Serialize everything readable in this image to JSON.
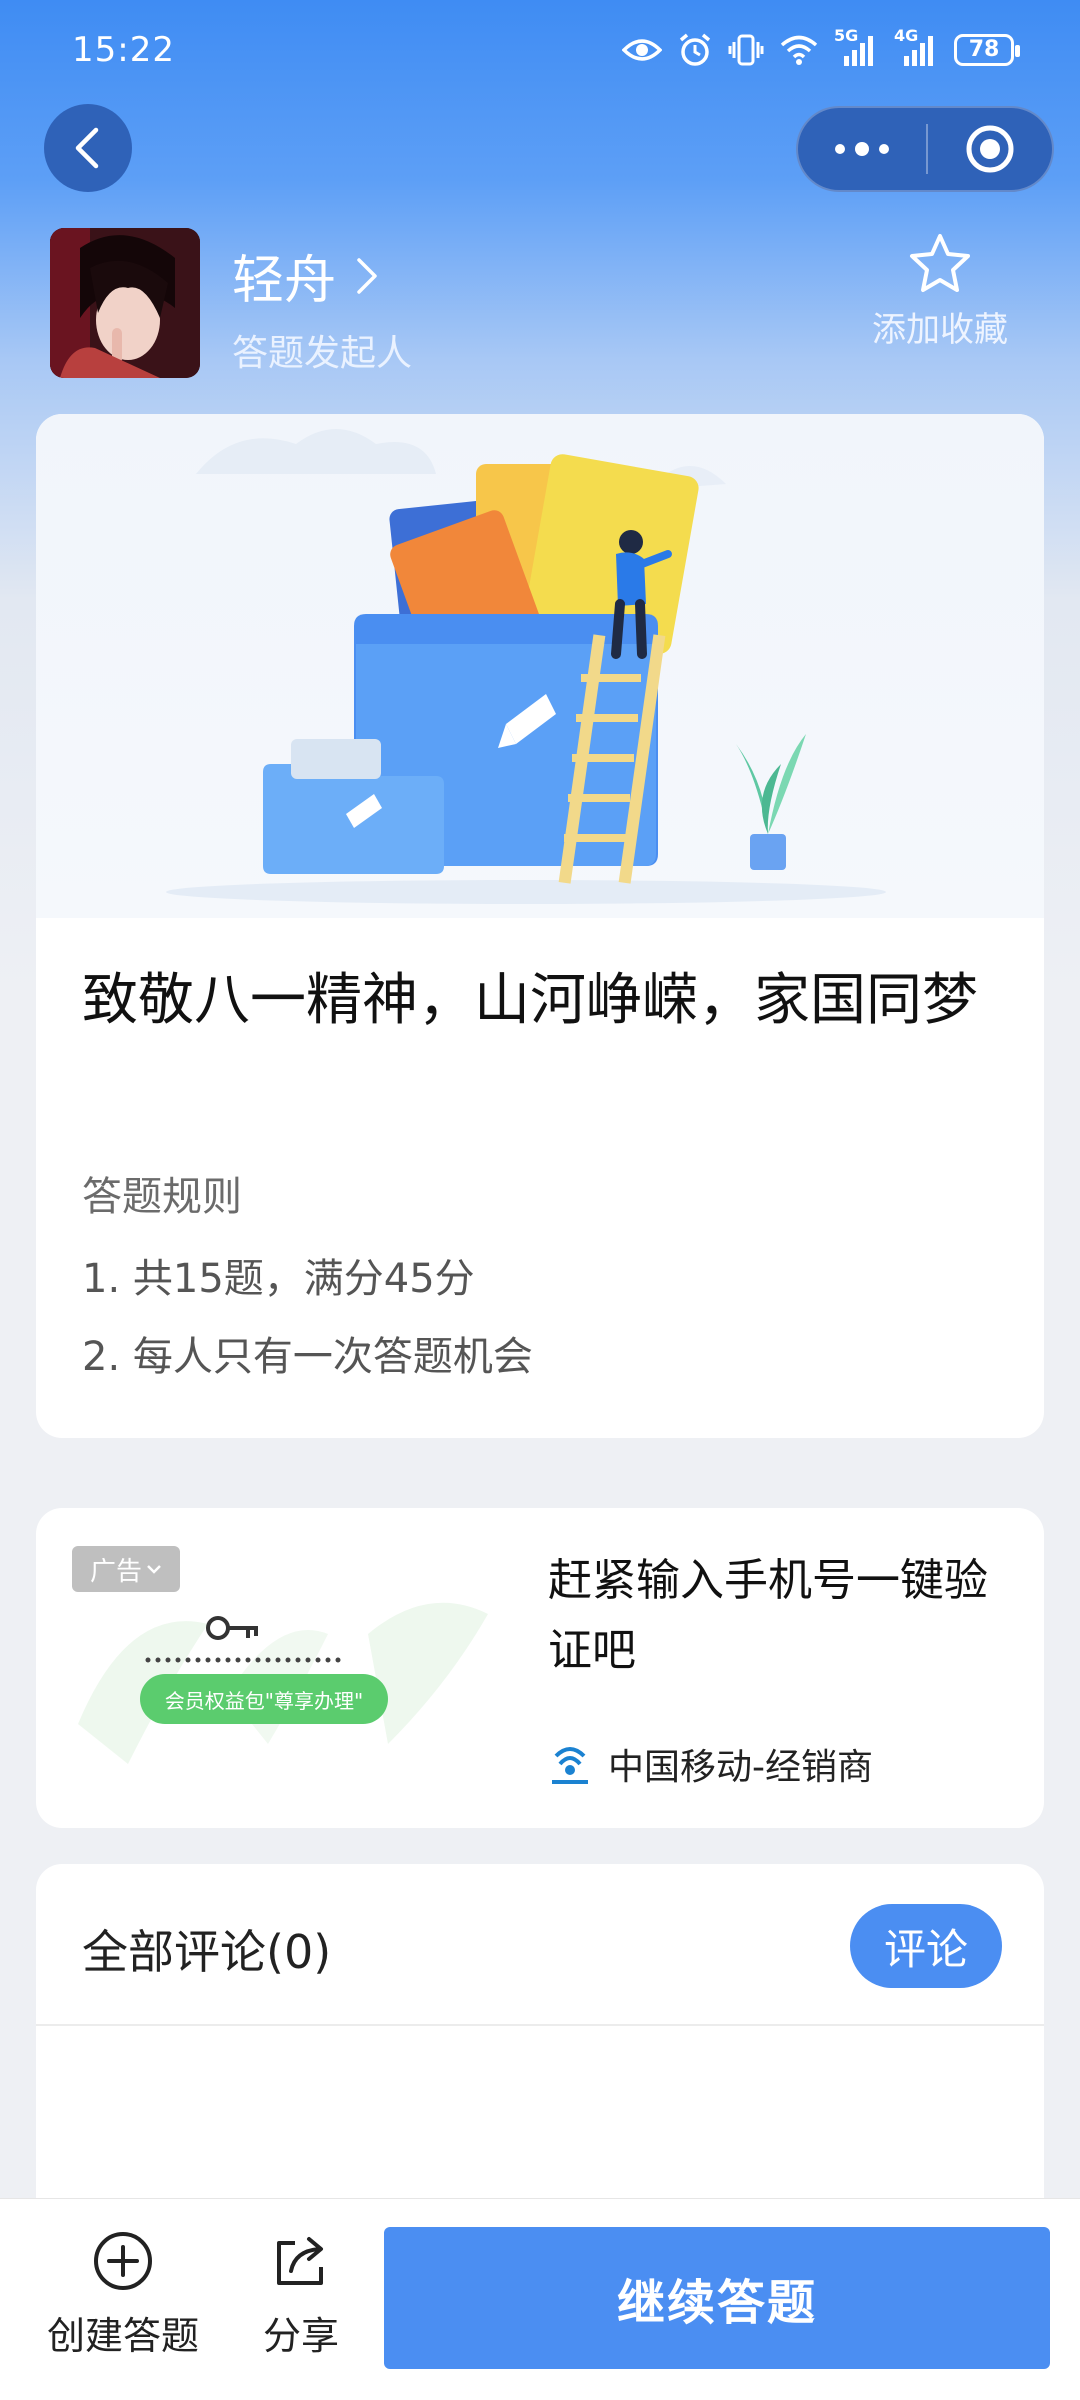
{
  "status_bar": {
    "time": "15:22",
    "network_1": "5G",
    "network_2": "4G",
    "battery": "78"
  },
  "nav": {
    "back_icon": "chevron-left-icon",
    "more_icon": "more-dots-icon",
    "target_icon": "target-icon"
  },
  "author": {
    "name": "轻舟",
    "role": "答题发起人",
    "favorite_label": "添加收藏"
  },
  "quiz": {
    "title": "致敬八一精神，山河峥嵘，家国同梦",
    "rules_heading": "答题规则",
    "rules": [
      "1. 共15题，满分45分",
      "2. 每人只有一次答题机会"
    ]
  },
  "ad": {
    "badge": "广告",
    "title": "赶紧输入手机号一键验证吧",
    "brand": "中国移动-经销商",
    "image_button": "会员权益包\"尊享办理\""
  },
  "comments": {
    "title": "全部评论(0)",
    "button": "评论"
  },
  "bottom": {
    "create_label": "创建答题",
    "share_label": "分享",
    "continue_label": "继续答题"
  },
  "colors": {
    "primary": "#4b8ef2",
    "header_top": "#3f8cf3",
    "capsule": "#2f62b8"
  }
}
